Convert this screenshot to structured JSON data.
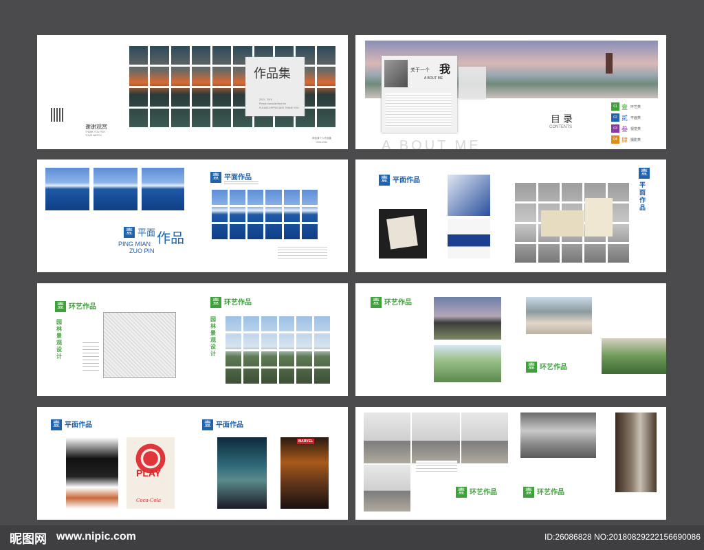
{
  "brochure": {
    "cover": {
      "title": "作品集",
      "years": "2013 - 2016",
      "subtitle_line1": "Please comsolid them for",
      "subtitle_line2": "PLEASE APPRECIATE THANK YOU",
      "thanks_cn": "谢谢观赏",
      "thanks_en1": "THANK YOU FOR",
      "thanks_en2": "YOUR WATCH",
      "footer_cn": "简依清个人作品集",
      "footer_years": "2011-2014"
    },
    "about": {
      "title_pre": "关于一个",
      "title_big": "我",
      "title_en": "A BOUT ME",
      "watermark": "A BOUT ME",
      "contents_cn": "目录",
      "contents_en": "CONTENTS",
      "toc": [
        {
          "num": "01",
          "char": "壹",
          "label": "环艺类",
          "color": "#3ea23a"
        },
        {
          "num": "02",
          "char": "贰",
          "label": "平面类",
          "color": "#1e63b0"
        },
        {
          "num": "03",
          "char": "叁",
          "label": "视觉类",
          "color": "#8a3aa0"
        },
        {
          "num": "04",
          "char": "肆",
          "label": "摄影类",
          "color": "#e38a1a"
        }
      ]
    },
    "graphic_intro": {
      "badge": "壹",
      "section": "平面作品",
      "big_pre": "平面",
      "big_main": "作品",
      "pinyin1": "PING MIAN",
      "pinyin2": "ZUO PIN"
    },
    "section_titles": {
      "graphic": "平面作品",
      "environment": "环艺作品",
      "garden": "园林景观设计"
    },
    "badge_char": "壹",
    "posters": {
      "play": "PLAY",
      "coke": "Coca-Cola",
      "marvel": "MARVEL"
    }
  },
  "footer": {
    "logo": "昵图网",
    "site": "www.nipic.com",
    "id_text": "ID:26086828 NO:20180829222156690086"
  }
}
